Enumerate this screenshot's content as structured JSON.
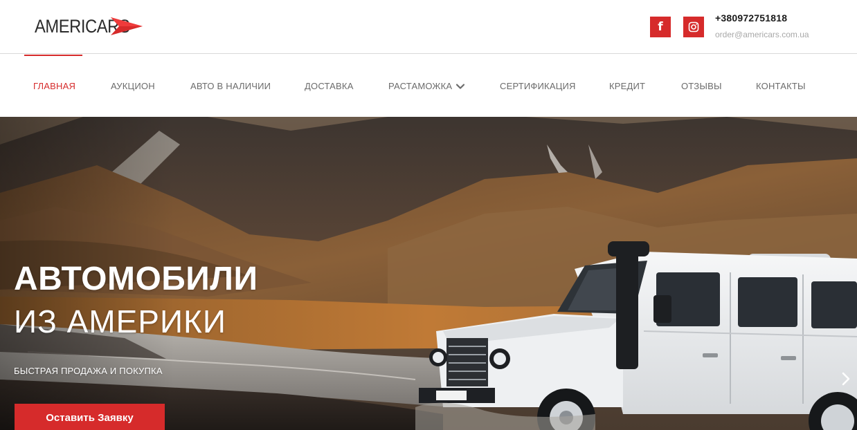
{
  "header": {
    "logo_text": "AMERICARS",
    "phone": "+380972751818",
    "email": "order@americars.com.ua",
    "social": [
      {
        "name": "facebook",
        "icon": "facebook-icon",
        "glyph": "f"
      },
      {
        "name": "instagram",
        "icon": "instagram-icon"
      }
    ]
  },
  "nav": {
    "items": [
      {
        "label": "ГЛАВНАЯ",
        "active": true
      },
      {
        "label": "АУКЦИОН"
      },
      {
        "label": "АВТО В НАЛИЧИИ"
      },
      {
        "label": "ДОСТАВКА"
      },
      {
        "label": "РАСТАМОЖКА",
        "has_dropdown": true,
        "icon": "chevron-down-icon"
      },
      {
        "label": "СЕРТИФИКАЦИЯ"
      },
      {
        "label": "КРЕДИТ"
      },
      {
        "label": "ОТЗЫВЫ"
      },
      {
        "label": "КОНТАКТЫ"
      }
    ]
  },
  "hero": {
    "title": "АВТОМОБИЛИ",
    "subtitle": "ИЗ АМЕРИКИ",
    "tagline": "БЫСТРАЯ ПРОДАЖА И ПОКУПКА",
    "cta_label": "Оставить Заявку",
    "next_icon": "chevron-right-icon"
  },
  "colors": {
    "accent": "#d62b2b",
    "nav_text": "#6b6b6b",
    "email_text": "#a8a8a8"
  }
}
